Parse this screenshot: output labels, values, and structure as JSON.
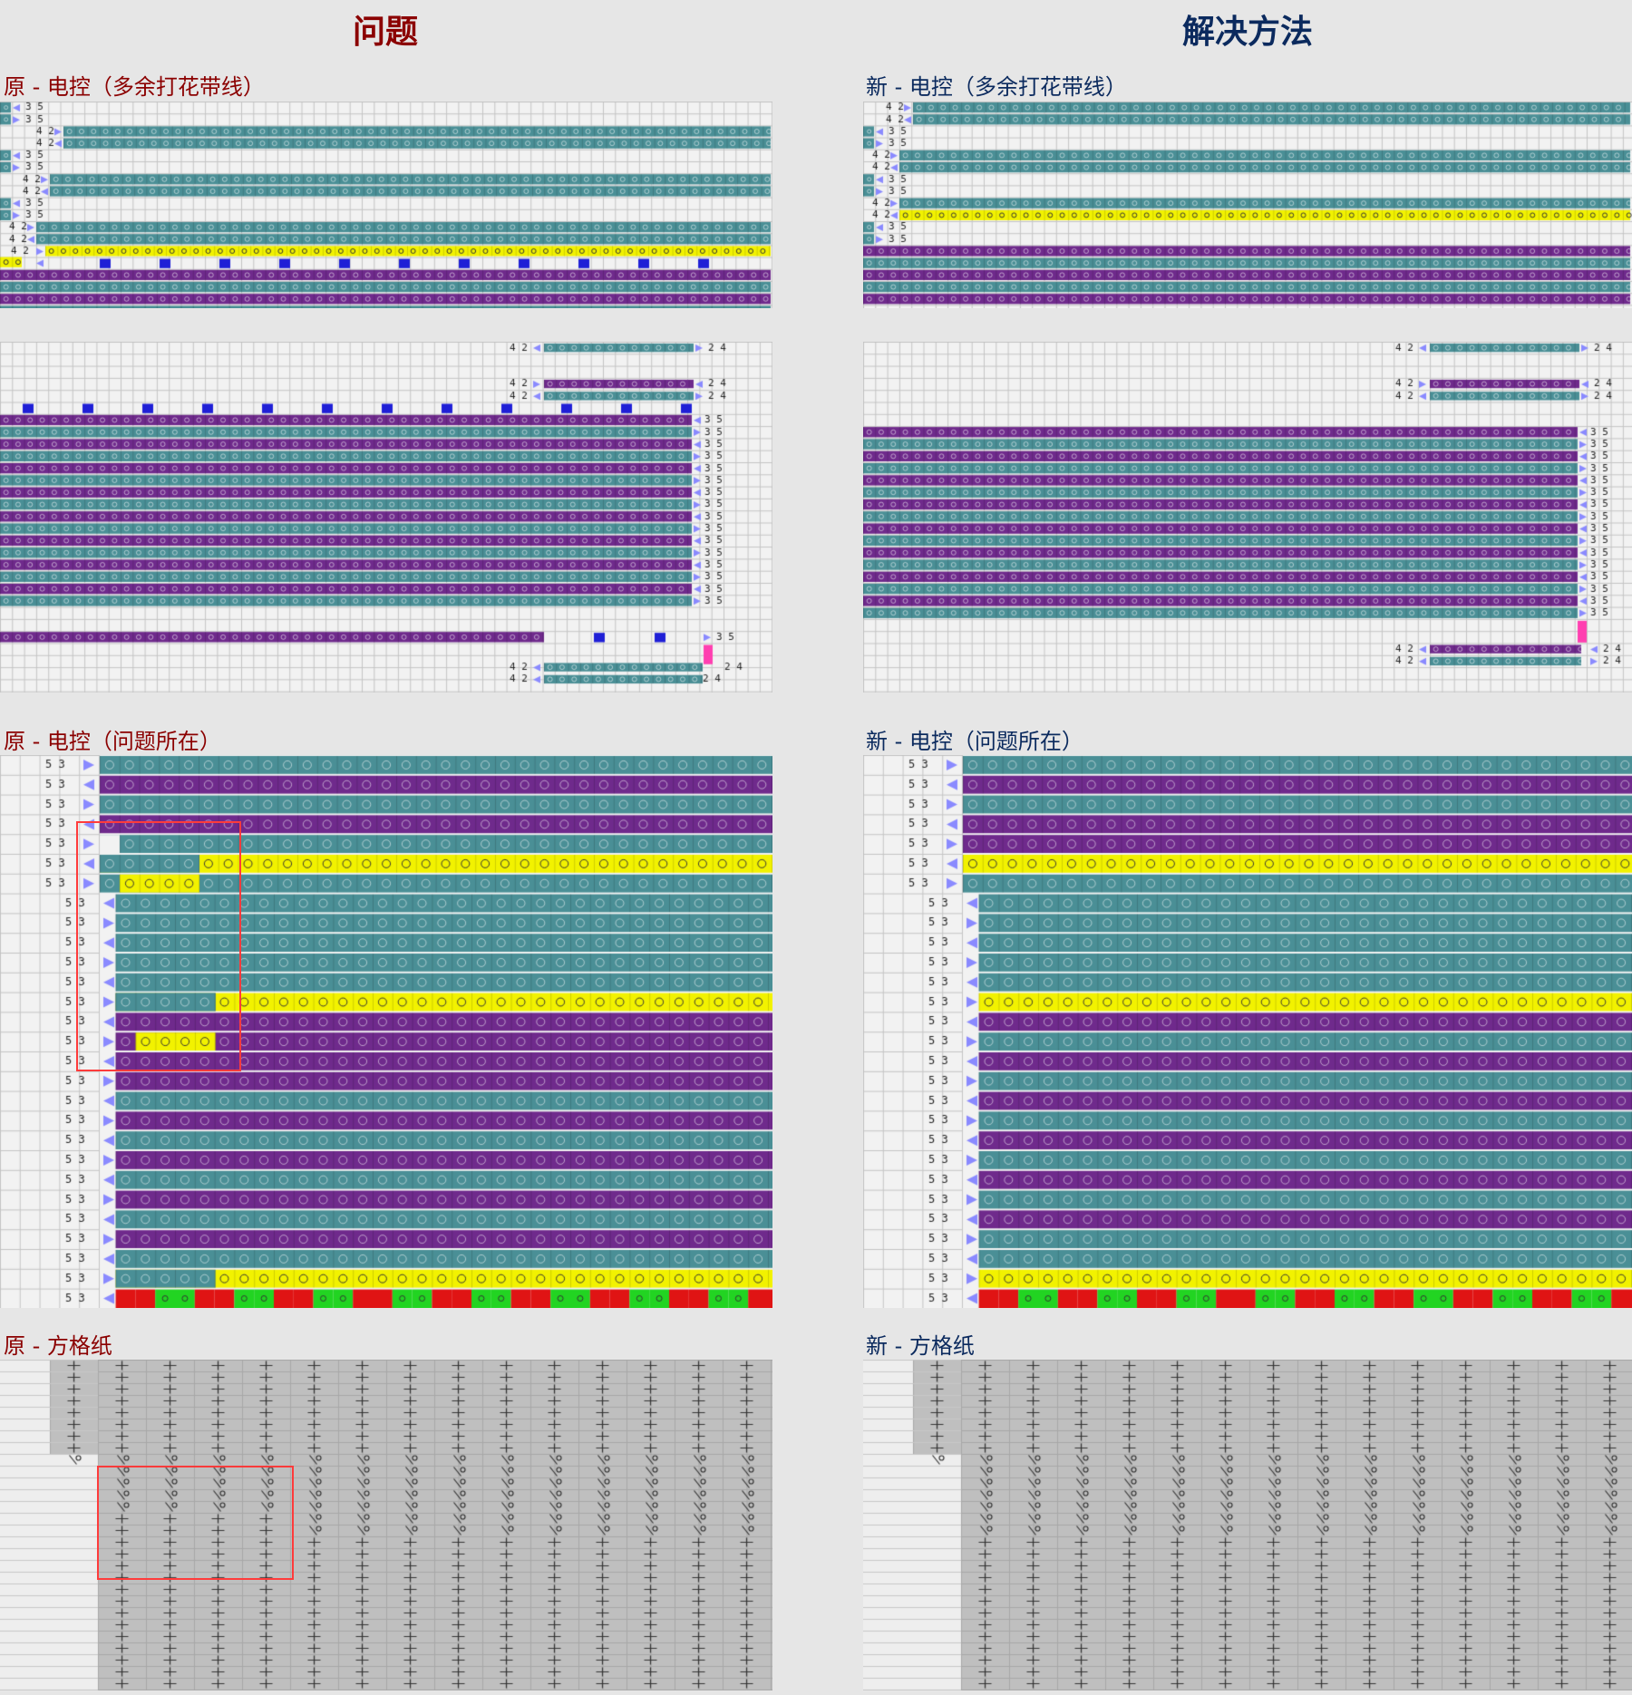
{
  "columns": {
    "left_title": "问题",
    "right_title": "解决方法"
  },
  "sections": {
    "left": {
      "extra_yarn": "原 - 电控（多余打花带线）",
      "problem": "原 - 电控（问题所在）",
      "grid_paper": "原 - 方格纸"
    },
    "right": {
      "extra_yarn": "新 - 电控（多余打花带线）",
      "problem": "新 - 电控（问题所在）",
      "grid_paper": "新 - 方格纸"
    }
  },
  "row_codes": [
    "4 2",
    "3 5",
    "2 4",
    "5 3"
  ],
  "colors": {
    "teal": "#4a8f96",
    "purple": "#6f2a8c",
    "yellow": "#f2f200",
    "red": "#e01414",
    "green": "#22d422",
    "blue": "#1f1fd6",
    "magenta": "#ff3fb0",
    "arrow": "#8a8aff",
    "grid_bg": "#f2f2f2",
    "grid_line": "#c4c4c4",
    "paper_fill": "#bfbfbf",
    "highlight_box": "#ff3b3b"
  },
  "icons": [
    "arrow-right-icon",
    "arrow-left-icon",
    "loop-stitch-icon",
    "plus-stitch-icon",
    "tuck-stitch-icon"
  ]
}
